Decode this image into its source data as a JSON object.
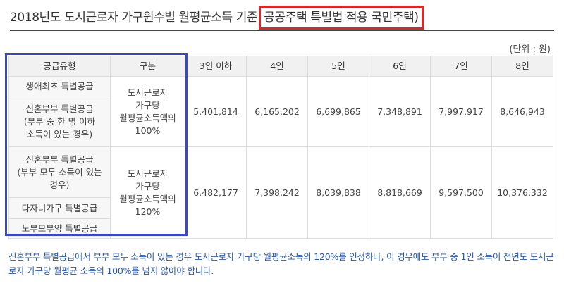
{
  "title_main": "2018년도 도시근로자 가구원수별 월평균소득 기준",
  "title_highlight": "공공주택 특별법 적용 국민주택)",
  "unit": "(단위 : 원)",
  "headers": [
    "공급유형",
    "구분",
    "3인 이하",
    "4인",
    "5인",
    "6인",
    "7인",
    "8인"
  ],
  "group1": {
    "types": [
      "생애최초 특별공급",
      "신혼부부 특별공급\n(부부 중 한 명 이하\n소득이 있는 경우)"
    ],
    "criterion": "도시근로자\n가구당\n월평균소득액의\n100%",
    "values": [
      "5,401,814",
      "6,165,202",
      "6,699,865",
      "7,348,891",
      "7,997,917",
      "8,646,943"
    ]
  },
  "group2": {
    "types": [
      "신혼부부 특별공급\n(부부 모두 소득이 있는\n경우)",
      "다자녀가구 특별공급",
      "노부모부양 특별공급"
    ],
    "criterion": "도시근로자\n가구당\n월평균소득액의\n120%",
    "values": [
      "6,482,177",
      "7,398,242",
      "8,039,838",
      "8,818,669",
      "9,597,500",
      "10,376,332"
    ]
  },
  "note": "신혼부부 특별공급에서 부부 모두 소득이 있는 경우 도시근로자 가구당 월평균소득의 120%를 인정하나, 이 경우에도 부부 중 1인 소득이 전년도 도시근로자 가구당 월평균 소득의 100%를 넘지 않아야 합니다.",
  "colors": {
    "highlight_red": "#e02424",
    "highlight_blue": "#3a48c8",
    "note_text": "#2a57a8"
  }
}
